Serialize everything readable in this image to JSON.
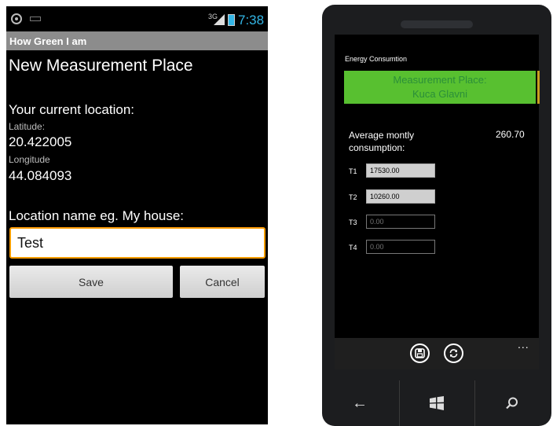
{
  "android": {
    "status_bar": {
      "network": "3G",
      "clock": "7:38"
    },
    "app_title": "How Green I am",
    "heading": "New Measurement Place",
    "current_location_label": "Your current location:",
    "latitude_label": "Latitude:",
    "latitude_value": "20.422005",
    "longitude_label": "Longitude",
    "longitude_value": "44.084093",
    "location_name_label": "Location name eg. My house:",
    "location_name_value": "Test",
    "save_label": "Save",
    "cancel_label": "Cancel",
    "colors": {
      "accent": "#33b5e5",
      "focus_border": "#ff9c00",
      "titlebar": "#8c8c8c"
    }
  },
  "windows_phone": {
    "app_title": "Energy Consumtion",
    "place_tile": {
      "line1": "Measurement Place:",
      "line2": "Kuca Glavni"
    },
    "average_label_line1": "Average montly",
    "average_label_line2": "consumption:",
    "average_value": "260.70",
    "tariffs": [
      {
        "label": "T1",
        "value": "17530.00",
        "placeholder": ""
      },
      {
        "label": "T2",
        "value": "10260.00",
        "placeholder": ""
      },
      {
        "label": "T3",
        "value": "",
        "placeholder": "0.00"
      },
      {
        "label": "T4",
        "value": "",
        "placeholder": "0.00"
      }
    ],
    "appbar": {
      "save_icon": "save-icon",
      "refresh_icon": "refresh-icon",
      "more": "..."
    },
    "hardware": {
      "back_icon": "back-arrow-icon",
      "start_icon": "windows-logo-icon",
      "search_icon": "search-icon"
    },
    "colors": {
      "tile": "#58c030",
      "tile_text": "#2b8f39"
    }
  }
}
